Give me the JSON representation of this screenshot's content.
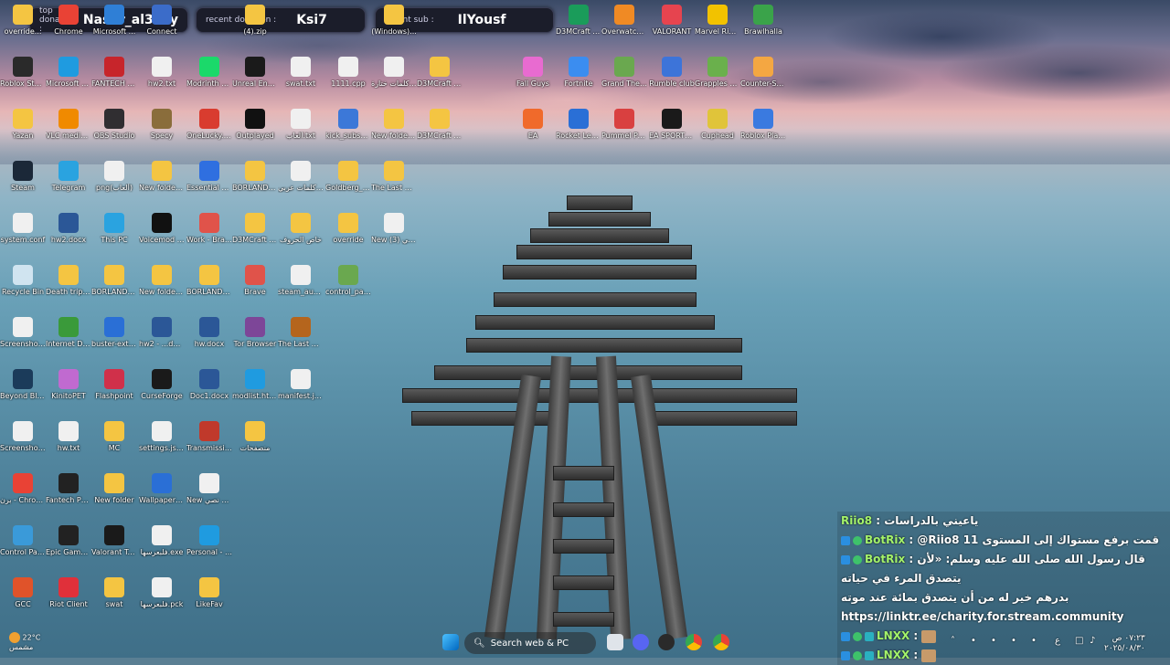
{
  "alerts": {
    "top_donator": {
      "label": "top donator :",
      "value": "Naser_al3nzy"
    },
    "recent_donation": {
      "label": "recent donation :",
      "value": "Ksi7"
    },
    "recent_sub": {
      "label": "recent sub :",
      "value": "IlYousf"
    }
  },
  "desktop_icons": [
    {
      "label": "override...",
      "color": "#f4c542"
    },
    {
      "label": "Chrome",
      "color": "#e94235"
    },
    {
      "label": "Microsoft ...",
      "color": "#2f7fd6"
    },
    {
      "label": "Connect",
      "color": "#3b6cc9"
    },
    {
      "label": "(4).zip",
      "color": "#f4c542"
    },
    {
      "label": "(Windows)...",
      "color": "#f4c542"
    },
    {
      "label": "D3MCraft v8.4.1 Mod...",
      "color": "#1a9c5a"
    },
    {
      "label": "Overwatch 2",
      "color": "#f08a24"
    },
    {
      "label": "VALORANT",
      "color": "#e6444f"
    },
    {
      "label": "Marvel Rivals",
      "color": "#f2c200"
    },
    {
      "label": "Brawlhalla",
      "color": "#3aa34a"
    },
    {
      "label": "Roblox Studio",
      "color": "#2a2a2a"
    },
    {
      "label": "Microsoft Edge",
      "color": "#1f9be0"
    },
    {
      "label": "FANTECH MK83...",
      "color": "#c7252b"
    },
    {
      "label": "hw2.txt",
      "color": "#f0f0f0"
    },
    {
      "label": "Modrinth App",
      "color": "#1bd96a"
    },
    {
      "label": "Unreal Engine",
      "color": "#1a1a1a"
    },
    {
      "label": "swat.txt",
      "color": "#f0f0f0"
    },
    {
      "label": "1111.cpp",
      "color": "#f0f0f0"
    },
    {
      "label": "كلمات ختارة.txt",
      "color": "#f0f0f0"
    },
    {
      "label": "D3MCraft v8.4.1 Pris...",
      "color": "#f4c542"
    },
    {
      "label": "Fall Guys",
      "color": "#e86bd0"
    },
    {
      "label": "Fortnite",
      "color": "#3b8df0"
    },
    {
      "label": "Grand Theft Auto V Le...",
      "color": "#6aa84f"
    },
    {
      "label": "Rumble club",
      "color": "#3d74d9"
    },
    {
      "label": "Grapples Galore",
      "color": "#6ab04c"
    },
    {
      "label": "Counter-Strike 2",
      "color": "#f4a742"
    },
    {
      "label": "Yazan",
      "color": "#f4c542"
    },
    {
      "label": "VLC media player",
      "color": "#f08a00"
    },
    {
      "label": "OBS Studio",
      "color": "#302e31"
    },
    {
      "label": "Specy",
      "color": "#8a6d3b"
    },
    {
      "label": "OneLucky.Bl... BanderitaX...",
      "color": "#d93c2f"
    },
    {
      "label": "Outplayed",
      "color": "#111111"
    },
    {
      "label": "ألعاب.txt",
      "color": "#f0f0f0"
    },
    {
      "label": "kick_subscr...",
      "color": "#3c78d8"
    },
    {
      "label": "New folder (3)",
      "color": "#f4c542"
    },
    {
      "label": "D3MCraft v8.4.1 Clus...",
      "color": "#f4c542"
    },
    {
      "label": "EA",
      "color": "#f06a2b"
    },
    {
      "label": "Rocket League",
      "color": "#2a6fd6"
    },
    {
      "label": "Pummel Party",
      "color": "#d94040"
    },
    {
      "label": "EA SPORTS FC 25",
      "color": "#1a1a1a"
    },
    {
      "label": "Cuphead",
      "color": "#e0c43a"
    },
    {
      "label": "Roblox Player",
      "color": "#3a7ae0"
    },
    {
      "label": "Steam",
      "color": "#1b2838"
    },
    {
      "label": "Telegram",
      "color": "#2aa3e0"
    },
    {
      "label": "png(ألعاب)",
      "color": "#f0f0f0"
    },
    {
      "label": "New folder (4)",
      "color": "#f4c542"
    },
    {
      "label": "Essential Mod Installer",
      "color": "#2f6fe0"
    },
    {
      "label": "BORLAND C++ 5.02 ...",
      "color": "#f4c542"
    },
    {
      "label": "كلمات عربي.txt",
      "color": "#f0f0f0"
    },
    {
      "label": "Goldberg_L...",
      "color": "#f4c542"
    },
    {
      "label": "The Last Of Us",
      "color": "#f4c542"
    },
    {
      "label": "system.conf",
      "color": "#f0f0f0"
    },
    {
      "label": "hw2.docx",
      "color": "#2b5797"
    },
    {
      "label": "This PC",
      "color": "#2aa3e0"
    },
    {
      "label": "Voicemod V3",
      "color": "#111111"
    },
    {
      "label": "Work - Brave",
      "color": "#e0534a"
    },
    {
      "label": "D3MCraft v8.2 Cus...",
      "color": "#f4c542"
    },
    {
      "label": "خاص الحروف",
      "color": "#f4c542"
    },
    {
      "label": "override",
      "color": "#f4c542"
    },
    {
      "label": "New مستند نصي (3).txt",
      "color": "#f0f0f0"
    },
    {
      "label": "Recycle Bin",
      "color": "#d0e4f0"
    },
    {
      "label": "Death trips (Windows)",
      "color": "#f4c542"
    },
    {
      "label": "BORLAND C++ 5.02 ...",
      "color": "#f4c542"
    },
    {
      "label": "New folder (2)",
      "color": "#f4c542"
    },
    {
      "label": "BORLAND C++",
      "color": "#f4c542"
    },
    {
      "label": "Brave",
      "color": "#e0534a"
    },
    {
      "label": "steam_autop...",
      "color": "#f0f0f0"
    },
    {
      "label": "control_pan...",
      "color": "#6aa84f"
    },
    {
      "label": "Screenshot...",
      "color": "#f0f0f0"
    },
    {
      "label": "Internet Downlo...",
      "color": "#3a9a3a"
    },
    {
      "label": "buster-exten... (1).exe",
      "color": "#2a6fd6"
    },
    {
      "label": "hw2 - ...docx",
      "color": "#2b5797"
    },
    {
      "label": "hw.docx",
      "color": "#2b5797"
    },
    {
      "label": "Tor Browser",
      "color": "#7d4698"
    },
    {
      "label": "The Last Of Us Par...",
      "color": "#b5651d"
    },
    {
      "label": "Beyond Blue",
      "color": "#1b3b5a"
    },
    {
      "label": "KinitoPET",
      "color": "#c06ad0"
    },
    {
      "label": "Flashpoint",
      "color": "#d0304a"
    },
    {
      "label": "CurseForge",
      "color": "#1a1a1a"
    },
    {
      "label": "Doc1.docx",
      "color": "#2b5797"
    },
    {
      "label": "modlist.html",
      "color": "#1f9be0"
    },
    {
      "label": "manifest.json",
      "color": "#f0f0f0"
    },
    {
      "label": "Screenshot_...",
      "color": "#f0f0f0"
    },
    {
      "label": "hw.txt",
      "color": "#f0f0f0"
    },
    {
      "label": "MC",
      "color": "#f4c542"
    },
    {
      "label": "settings.json",
      "color": "#f0f0f0"
    },
    {
      "label": "Transmission Qt Client",
      "color": "#c0392b"
    },
    {
      "label": "منصفحات",
      "color": "#f4c542"
    },
    {
      "label": "برن - Chrome",
      "color": "#e94235"
    },
    {
      "label": "Fantech Phantom...",
      "color": "#222222"
    },
    {
      "label": "New folder",
      "color": "#f4c542"
    },
    {
      "label": "Wallpaper Engine",
      "color": "#2a6fd6"
    },
    {
      "label": "New مستند نصي.txt",
      "color": "#f0f0f0"
    },
    {
      "label": "Control Panel",
      "color": "#3a9ad9"
    },
    {
      "label": "Epic Games Launcher",
      "color": "#222222"
    },
    {
      "label": "Valorant Tracker",
      "color": "#1a1a1a"
    },
    {
      "label": "فلبعرسها.exe",
      "color": "#f0f0f0"
    },
    {
      "label": "Personal - Edge",
      "color": "#1f9be0"
    },
    {
      "label": "GCC",
      "color": "#e0532a"
    },
    {
      "label": "Riot Client",
      "color": "#e0303a"
    },
    {
      "label": "swat",
      "color": "#f4c542"
    },
    {
      "label": "فلبعرسها.pck",
      "color": "#f0f0f0"
    },
    {
      "label": "LikeFav",
      "color": "#f4c542"
    }
  ],
  "chat": [
    {
      "user": "Riio8",
      "text": "ياعيني بالدراسات"
    },
    {
      "user": "BotRix",
      "text": "@Riio8 قمت برفع مستواك إلى المستوى 11"
    },
    {
      "user": "BotRix",
      "text": "قال رسول الله صلى الله عليه وسلم: «لأن يتصدق المرء في حياته"
    },
    {
      "user": "",
      "text": "بدرهم خير له من أن يتصدق بمائة عند موته"
    },
    {
      "user": "",
      "text": "https://linktr.ee/charity.for.stream.community"
    },
    {
      "user": "LNXX",
      "text": ""
    },
    {
      "user": "LNXX",
      "text": ""
    }
  ],
  "taskbar": {
    "weather_temp": "22°C",
    "weather_desc": "مشمس",
    "search_placeholder": "Search web & PC",
    "time": "٠٧:٢٣ ص",
    "date": "٢٠٢٥/٠٨/٣٠",
    "lang": "ع"
  }
}
